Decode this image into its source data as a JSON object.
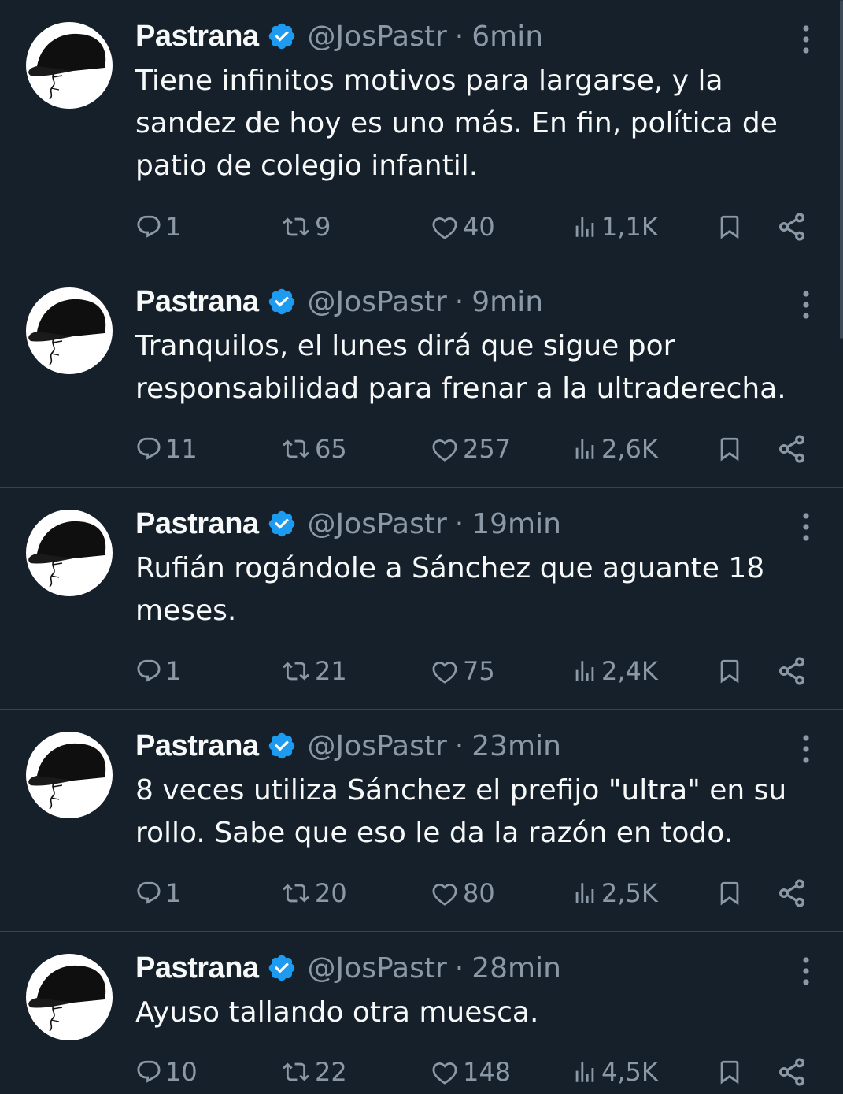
{
  "colors": {
    "background": "#15202b",
    "text_primary": "#f7f9f9",
    "text_secondary": "#8b98a5",
    "verified_badge": "#1d9bf0",
    "divider": "#38444d"
  },
  "tweets": [
    {
      "name": "Pastrana",
      "handle": "@JosPastr",
      "separator": "·",
      "time": "6min",
      "text": "Tiene infinitos motivos para largarse, y la\nsandez de hoy es uno más. En fin, política de\npatio de colegio infantil.",
      "replies": "1",
      "retweets": "9",
      "likes": "40",
      "views": "1,1K"
    },
    {
      "name": "Pastrana",
      "handle": "@JosPastr",
      "separator": "·",
      "time": "9min",
      "text": "Tranquilos, el lunes dirá que sigue por\nresponsabilidad para frenar a la ultraderecha.",
      "replies": "11",
      "retweets": "65",
      "likes": "257",
      "views": "2,6K"
    },
    {
      "name": "Pastrana",
      "handle": "@JosPastr",
      "separator": "·",
      "time": "19min",
      "text": "Rufián rogándole a Sánchez que aguante 18\nmeses.",
      "replies": "1",
      "retweets": "21",
      "likes": "75",
      "views": "2,4K"
    },
    {
      "name": "Pastrana",
      "handle": "@JosPastr",
      "separator": "·",
      "time": "23min",
      "text": "8 veces utiliza Sánchez el prefijo \"ultra\" en su\nrollo. Sabe que eso le da la razón en todo.",
      "replies": "1",
      "retweets": "20",
      "likes": "80",
      "views": "2,5K"
    },
    {
      "name": "Pastrana",
      "handle": "@JosPastr",
      "separator": "·",
      "time": "28min",
      "text": "Ayuso tallando otra muesca.",
      "replies": "10",
      "retweets": "22",
      "likes": "148",
      "views": "4,5K"
    }
  ]
}
